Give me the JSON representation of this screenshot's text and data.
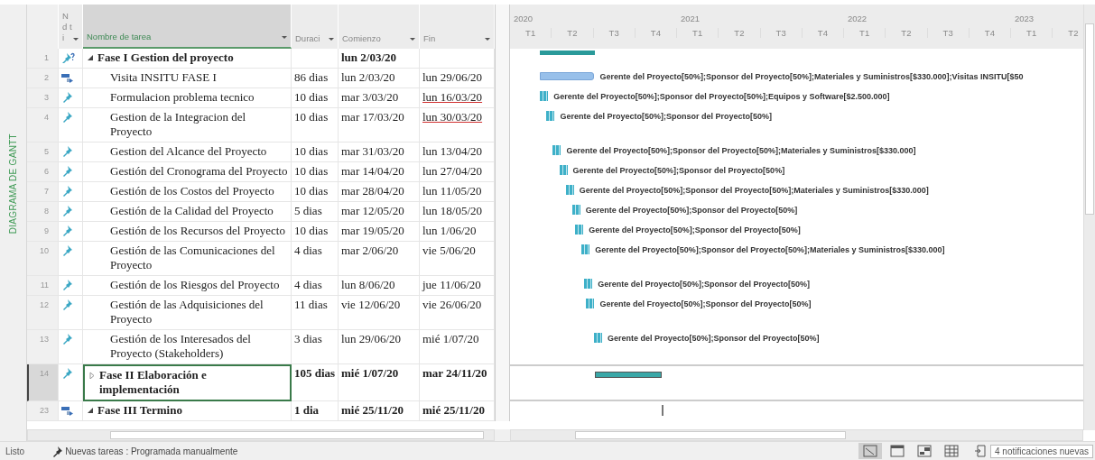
{
  "side_label": "DIAGRAMA DE GANTT",
  "columns": [
    {
      "label": "N d ti",
      "selected": false
    },
    {
      "label": "Nombre de tarea",
      "selected": true
    },
    {
      "label": "Duraci",
      "selected": false
    },
    {
      "label": "Comienzo",
      "selected": false
    },
    {
      "label": "Fin",
      "selected": false
    }
  ],
  "timescale": {
    "years": [
      "2020",
      "2021",
      "2022",
      "2023"
    ],
    "quarters": [
      "T1",
      "T2",
      "T3",
      "T4",
      "T1",
      "T2",
      "T3",
      "T4",
      "T1",
      "T2",
      "T3",
      "T4",
      "T1",
      "T2"
    ]
  },
  "tasks": [
    {
      "id": "1",
      "kind": "unscheduled",
      "name": "Fase I Gestion del proyecto",
      "start": "lun 2/03/20",
      "summary": true,
      "expanded": true,
      "selected": false,
      "children": [
        {
          "id": "2",
          "kind": "auto",
          "name": "Visita INSITU FASE I",
          "duration": "86 dias",
          "start": "lun 2/03/20",
          "finish": "lun 29/06/20",
          "finish_warning": false,
          "summary": false,
          "selected": false,
          "resources": "Gerente del Proyecto[50%];Sponsor del Proyecto[50%];Materiales y Suministros[$330.000];Visitas INSITU[$50"
        },
        {
          "id": "3",
          "kind": "manual",
          "name": "Formulacion problema tecnico",
          "duration": "10 dias",
          "start": "mar 3/03/20",
          "finish": "lun 16/03/20",
          "finish_warning": true,
          "summary": false,
          "selected": false,
          "resources": "Gerente del Proyecto[50%];Sponsor del Proyecto[50%];Equipos y Software[$2.500.000]"
        },
        {
          "id": "4",
          "kind": "manual",
          "name": "Gestion de la Integracion del Proyecto",
          "duration": "10 dias",
          "start": "mar 17/03/20",
          "finish": "lun 30/03/20",
          "finish_warning": true,
          "summary": false,
          "selected": false,
          "resources": "Gerente del Proyecto[50%];Sponsor del Proyecto[50%]"
        },
        {
          "id": "5",
          "kind": "manual",
          "name": "Gestion del Alcance del Proyecto",
          "duration": "10 dias",
          "start": "mar 31/03/20",
          "finish": "lun 13/04/20",
          "finish_warning": false,
          "summary": false,
          "selected": false,
          "resources": "Gerente del Proyecto[50%];Sponsor del Proyecto[50%];Materiales y Suministros[$330.000]"
        },
        {
          "id": "6",
          "kind": "manual",
          "name": "Gestión del Cronograma del Proyecto",
          "duration": "10 dias",
          "start": "mar 14/04/20",
          "finish": "lun 27/04/20",
          "finish_warning": false,
          "summary": false,
          "selected": false,
          "resources": "Gerente del Proyecto[50%];Sponsor del Proyecto[50%]"
        },
        {
          "id": "7",
          "kind": "manual",
          "name": "Gestión de los Costos del Proyecto",
          "duration": "10 dias",
          "start": "mar 28/04/20",
          "finish": "lun 11/05/20",
          "finish_warning": false,
          "summary": false,
          "selected": false,
          "resources": "Gerente del Proyecto[50%];Sponsor del Proyecto[50%];Materiales y Suministros[$330.000]"
        },
        {
          "id": "8",
          "kind": "manual",
          "name": "Gestión de la Calidad del Proyecto",
          "duration": "5 dias",
          "start": "mar 12/05/20",
          "finish": "lun 18/05/20",
          "finish_warning": false,
          "summary": false,
          "selected": false,
          "resources": "Gerente del Proyecto[50%];Sponsor del Proyecto[50%]"
        },
        {
          "id": "9",
          "kind": "manual",
          "name": "Gestión de los Recursos del Proyecto",
          "duration": "10 dias",
          "start": "mar 19/05/20",
          "finish": "lun 1/06/20",
          "finish_warning": false,
          "summary": false,
          "selected": false,
          "resources": "Gerente del Proyecto[50%];Sponsor del Proyecto[50%]"
        },
        {
          "id": "10",
          "kind": "manual",
          "name": "Gestión de las Comunicaciones del Proyecto",
          "duration": "4 dias",
          "start": "mar 2/06/20",
          "finish": "vie 5/06/20",
          "finish_warning": false,
          "summary": false,
          "selected": false,
          "resources": "Gerente del Proyecto[50%];Sponsor del Proyecto[50%];Materiales y Suministros[$330.000]"
        },
        {
          "id": "11",
          "kind": "manual",
          "name": "Gestión de los Riesgos del Proyecto",
          "duration": "4 dias",
          "start": "lun 8/06/20",
          "finish": "jue 11/06/20",
          "finish_warning": false,
          "summary": false,
          "selected": false,
          "resources": "Gerente del Proyecto[50%];Sponsor del Proyecto[50%]"
        },
        {
          "id": "12",
          "kind": "manual",
          "name": "Gestión de las Adquisiciones del Proyecto",
          "duration": "11 dias",
          "start": "vie 12/06/20",
          "finish": "vie 26/06/20",
          "finish_warning": false,
          "summary": false,
          "selected": false,
          "resources": "Gerente del Froyecto[50%];Sponsor del Proyecto[50%]"
        },
        {
          "id": "13",
          "kind": "manual",
          "name": "Gestión de los Interesados del Proyecto (Stakeholders)",
          "duration": "3 dias",
          "start": "lun 29/06/20",
          "finish": "mié 1/07/20",
          "finish_warning": false,
          "summary": false,
          "selected": false,
          "resources": "Gerente del Proyecto[50%];Sponsor del Proyecto[50%]"
        }
      ]
    },
    {
      "id": "14",
      "kind": "manual",
      "name": "Fase II Elaboración e implementación",
      "duration": "105 dias",
      "start": "mié 1/07/20",
      "finish": "mar 24/11/20",
      "finish_warning": false,
      "summary": true,
      "expanded": false,
      "selected": true
    },
    {
      "id": "23",
      "kind": "auto",
      "name": "Fase III Termino",
      "duration": "1 dia",
      "start": "mié 25/11/20",
      "finish": "mié 25/11/20",
      "finish_warning": false,
      "summary": true,
      "expanded": true,
      "selected": false
    }
  ],
  "status_bar": {
    "mode": "Listo",
    "new_tasks": "Nuevas tareas : Programada manualmente",
    "notifications": "4 notificaciones nuevas"
  }
}
